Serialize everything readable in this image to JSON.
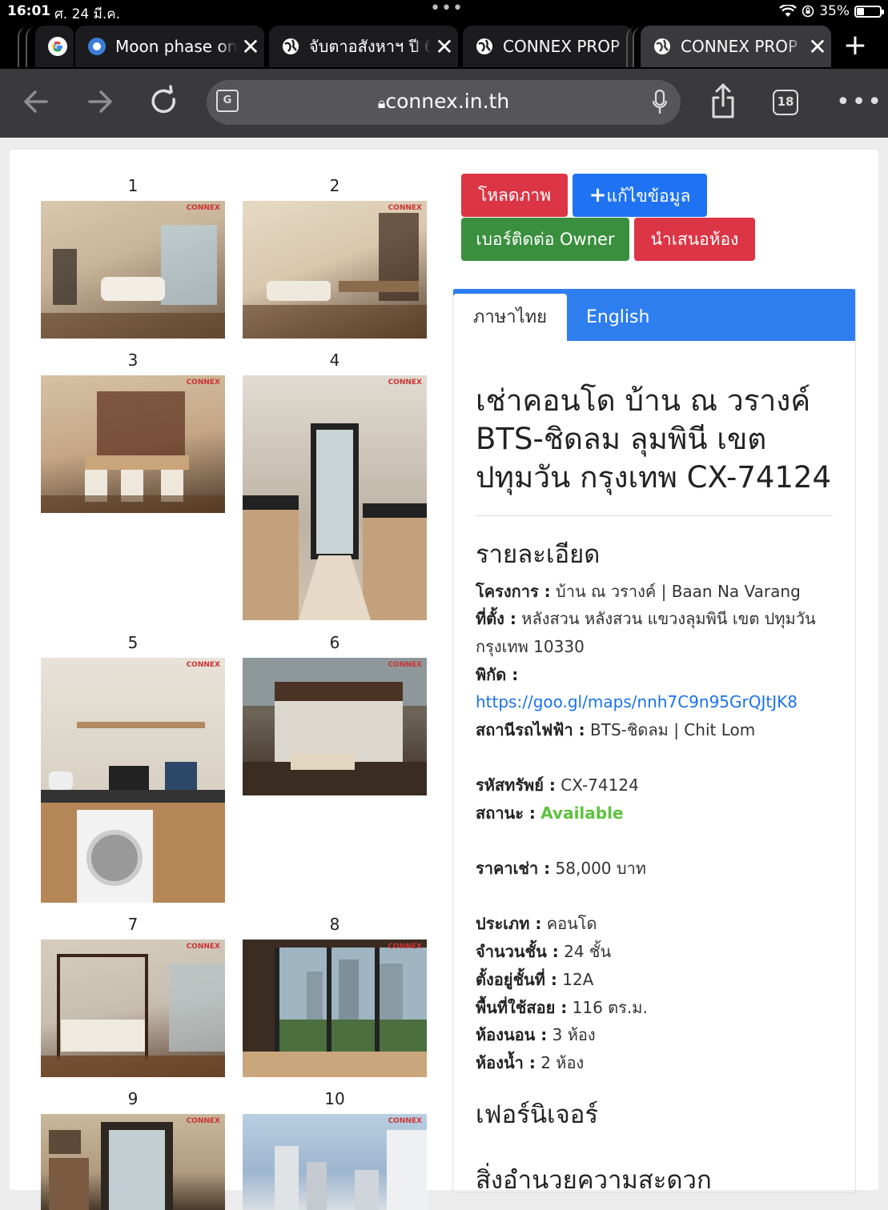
{
  "status": {
    "time": "16:01",
    "date": "ศ. 24 มี.ค.",
    "dots": "•••",
    "battery": "35%"
  },
  "tabs": [
    {
      "title": "Moon phase on",
      "active": false
    },
    {
      "title": "จับตาอสังหาฯ ปี 6",
      "active": false
    },
    {
      "title": "CONNEX PROP",
      "active": false
    },
    {
      "title": "CONNEX PROP",
      "active": true
    }
  ],
  "toolbar": {
    "url": "connex.in.th",
    "tab_count": "18"
  },
  "photos": [
    {
      "num": "1",
      "colors": [
        "#c9b59a",
        "#6d5a48"
      ]
    },
    {
      "num": "2",
      "colors": [
        "#d9c7ae",
        "#5a4636"
      ]
    },
    {
      "num": "3",
      "colors": [
        "#c4a686",
        "#4e3a2a"
      ]
    },
    {
      "num": "4",
      "colors": [
        "#bdb3a4",
        "#6b5a46"
      ]
    },
    {
      "num": "5",
      "colors": [
        "#d8d0c3",
        "#8a6b4c"
      ]
    },
    {
      "num": "6",
      "colors": [
        "#5e5448",
        "#d8d4cc"
      ]
    },
    {
      "num": "7",
      "colors": [
        "#c8beb0",
        "#5a4232"
      ]
    },
    {
      "num": "8",
      "colors": [
        "#7d8a8e",
        "#3b2c22"
      ]
    },
    {
      "num": "9",
      "colors": [
        "#b19c80",
        "#4a3a2c"
      ]
    },
    {
      "num": "10",
      "colors": [
        "#9db6cf",
        "#d8dde2"
      ]
    }
  ],
  "photo_logo": "CONNEX",
  "buttons": {
    "load_photo": "โหลดภาพ",
    "edit": "แก้ไขข้อมูล",
    "owner_contact": "เบอร์ติดต่อ Owner",
    "present": "นำเสนอห้อง"
  },
  "lang_tabs": {
    "thai": "ภาษาไทย",
    "english": "English"
  },
  "listing": {
    "title": "เช่าคอนโด บ้าน ณ วรางค์ BTS-ชิดลม ลุมพินี เขต ปทุมวัน กรุงเทพ CX-74124",
    "details_heading": "รายละเอียด",
    "project_label": "โครงการ :",
    "project_value": "บ้าน ณ วรางค์ | Baan Na Varang",
    "location_label": "ที่ตั้ง :",
    "location_value": "หลังสวน หลังสวน แขวงลุมพินี เขต ปทุมวัน กรุงเทพ 10330",
    "coords_label": "พิกัด :",
    "coords_link": "https://goo.gl/maps/nnh7C9n95GrQJtJK8",
    "bts_label": "สถานีรถไฟฟ้า :",
    "bts_value": "BTS-ชิดลม | Chit Lom",
    "code_label": "รหัสทรัพย์ :",
    "code_value": "CX-74124",
    "status_label": "สถานะ :",
    "status_value": "Available",
    "price_label": "ราคาเช่า :",
    "price_value": "58,000 บาท",
    "type_label": "ประเภท :",
    "type_value": "คอนโด",
    "floors_label": "จำนวนชั้น :",
    "floors_value": "24 ชั้น",
    "floor_label": "ตั้งอยู่ชั้นที่ :",
    "floor_value": "12A",
    "area_label": "พื้นที่ใช้สอย :",
    "area_value": "116 ตร.ม.",
    "bed_label": "ห้องนอน :",
    "bed_value": "3 ห้อง",
    "bath_label": "ห้องน้ำ :",
    "bath_value": "2 ห้อง",
    "furniture_heading": "เฟอร์นิเจอร์",
    "facilities_heading": "สิ่งอำนวยความสะดวก"
  }
}
